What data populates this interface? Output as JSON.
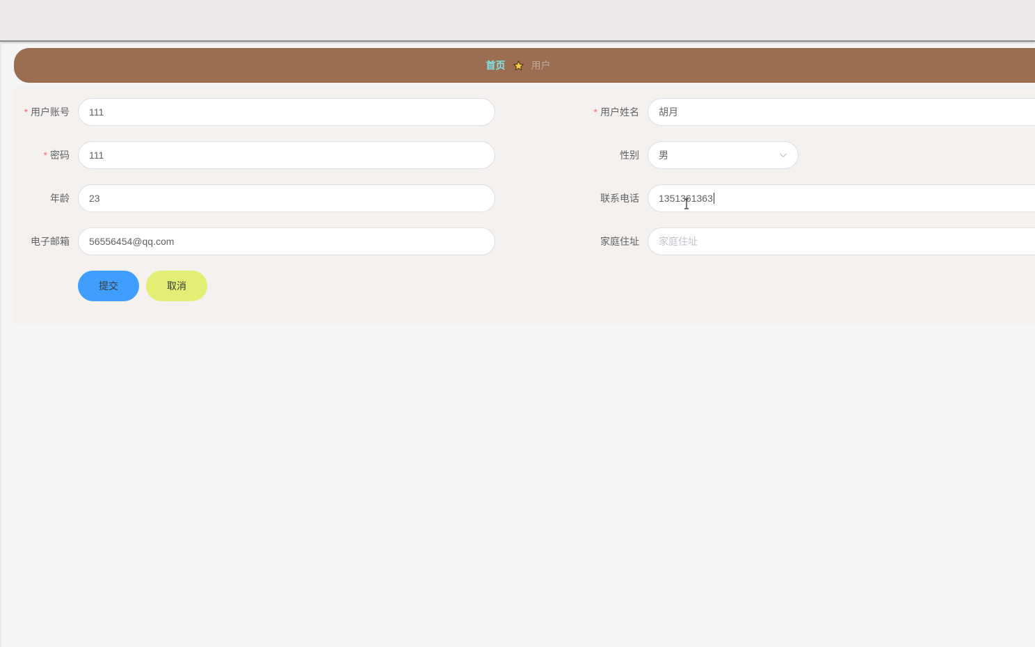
{
  "breadcrumb": {
    "home": "首页",
    "current": "用户",
    "separator_icon": "star-icon"
  },
  "form": {
    "account": {
      "label": "用户账号",
      "required": "*",
      "value": "111"
    },
    "name": {
      "label": "用户姓名",
      "required": "*",
      "value": "胡月"
    },
    "password": {
      "label": "密码",
      "required": "*",
      "value": "111"
    },
    "gender": {
      "label": "性别",
      "value": "男"
    },
    "age": {
      "label": "年龄",
      "value": "23"
    },
    "phone": {
      "label": "联系电话",
      "value": "1351361363"
    },
    "email": {
      "label": "电子邮箱",
      "value": "56556454@qq.com"
    },
    "address": {
      "label": "家庭住址",
      "placeholder": "家庭住址"
    }
  },
  "buttons": {
    "submit": "提交",
    "cancel": "取消"
  },
  "colors": {
    "breadcrumb_bg": "#9b6d51",
    "home_link": "#7fe3e8",
    "submit_bg": "#409eff",
    "cancel_bg": "#e3ee74",
    "required": "#f56c6c"
  }
}
